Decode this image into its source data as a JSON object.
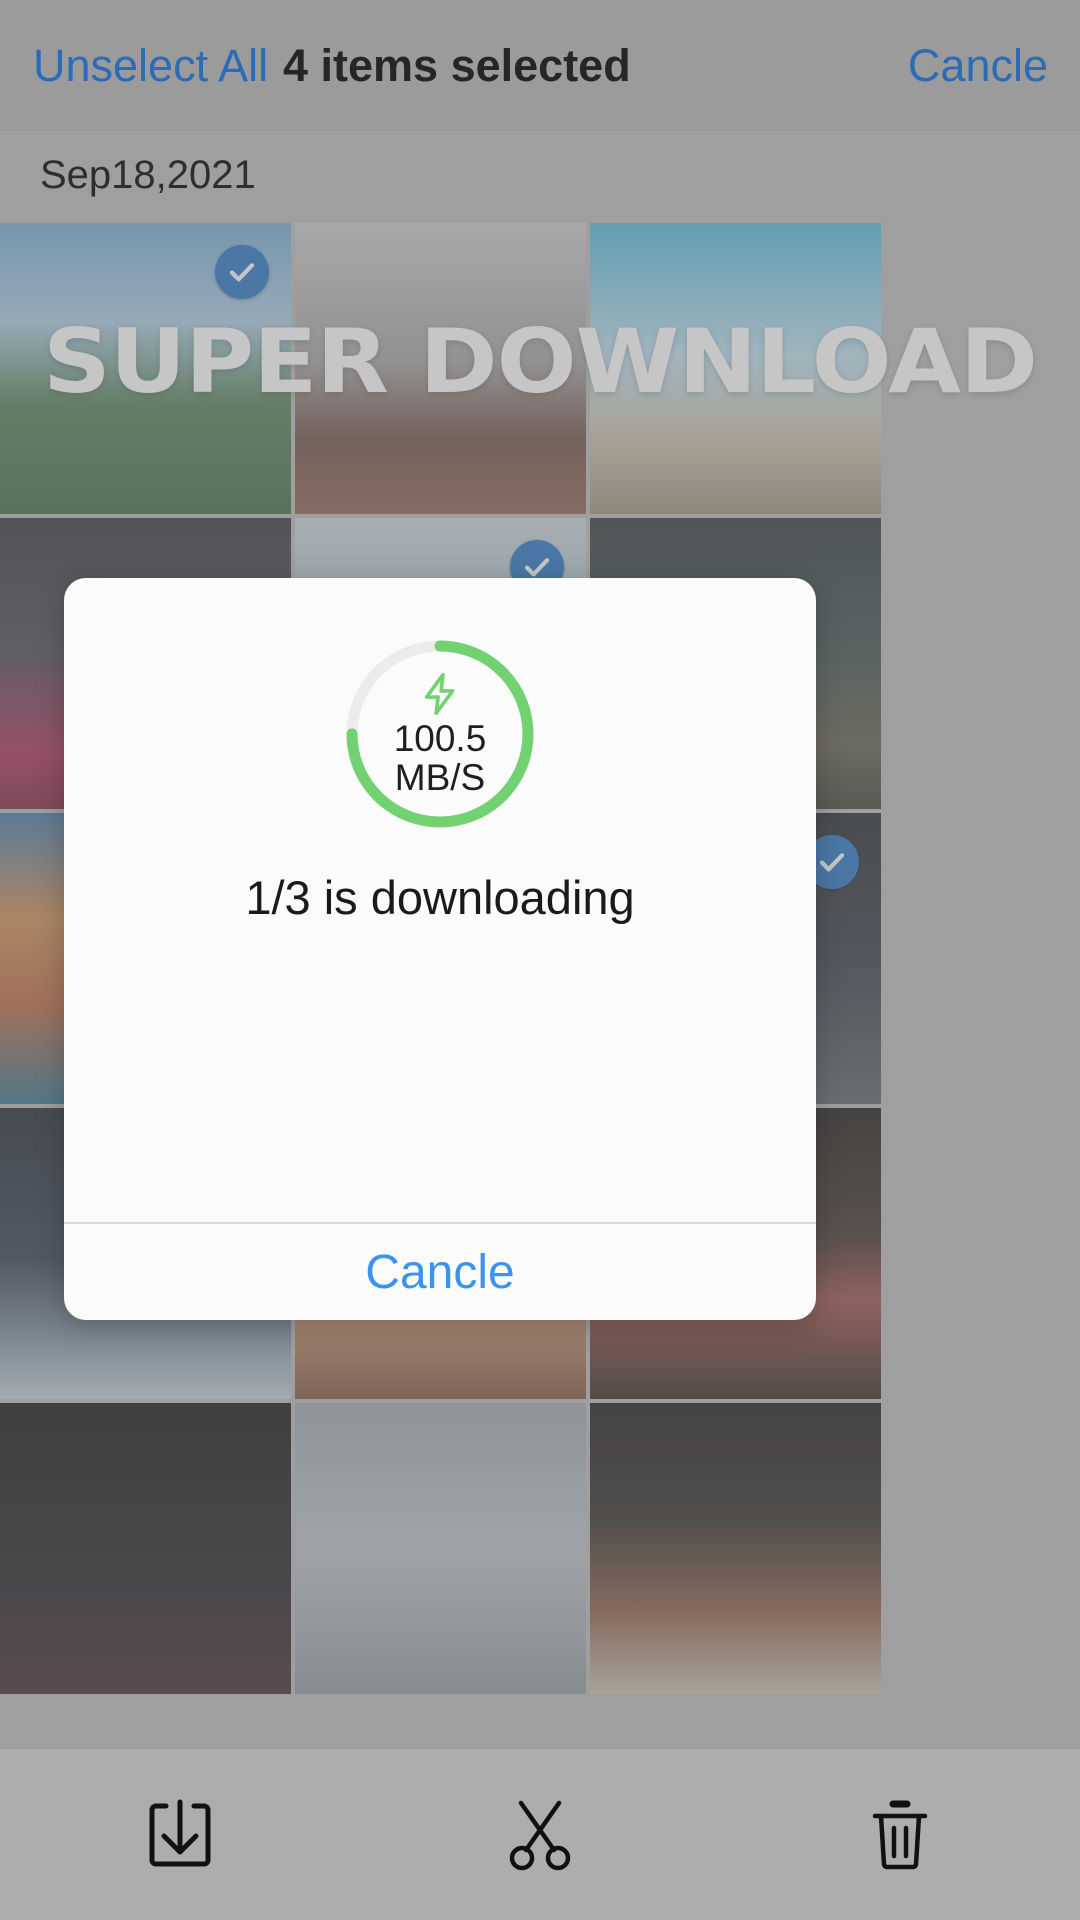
{
  "topbar": {
    "unselect_label": "Unselect All",
    "selection_count_label": "4 items selected",
    "cancel_label": "Cancle",
    "link_color": "#2b6cb8"
  },
  "date_header": {
    "label": "Sep18,2021"
  },
  "watermark": {
    "text": "SUPER DOWNLOAD"
  },
  "gallery": {
    "columns": 3,
    "tiles": [
      {
        "alt": "mountain-lake-landscape",
        "selected": true
      },
      {
        "alt": "woman-by-window-bw",
        "selected": false
      },
      {
        "alt": "santorini-blue-sky",
        "selected": false
      },
      {
        "alt": "woman-in-pink-dress",
        "selected": false
      },
      {
        "alt": "snowy-mountain-peak",
        "selected": true
      },
      {
        "alt": "cabin-in-forest",
        "selected": false
      },
      {
        "alt": "colorful-cliff-village",
        "selected": false
      },
      {
        "alt": "dark-interior-portrait",
        "selected": false
      },
      {
        "alt": "woman-in-dark-room",
        "selected": true
      },
      {
        "alt": "night-sky-with-flag",
        "selected": true
      },
      {
        "alt": "woman-with-curly-hair",
        "selected": false
      },
      {
        "alt": "woman-with-red-beret",
        "selected": false
      },
      {
        "alt": "dark-abstract-photo",
        "selected": false
      },
      {
        "alt": "cloudy-grey-sky",
        "selected": false
      },
      {
        "alt": "brick-wall-and-desk",
        "selected": false
      }
    ]
  },
  "dialog": {
    "speed_value": "100.5",
    "speed_unit": "MB/S",
    "status_text": "1/3 is downloading",
    "cancel_label": "Cancle",
    "progress_percent": 75,
    "gauge_color": "#72d272",
    "gauge_track_color": "#ececec",
    "cancel_color": "#3b93f0",
    "bolt_icon": "lightning-bolt-icon"
  },
  "toolbar": {
    "items": [
      {
        "name": "download-icon",
        "label": "Download"
      },
      {
        "name": "scissors-icon",
        "label": "Cut"
      },
      {
        "name": "trash-icon",
        "label": "Delete"
      }
    ]
  }
}
